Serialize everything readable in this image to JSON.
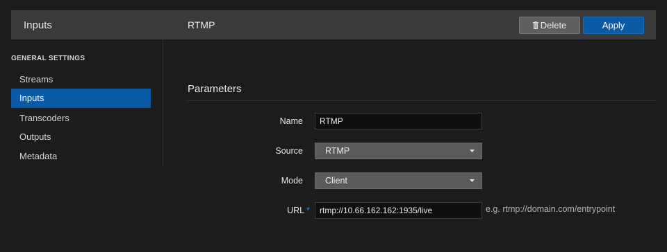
{
  "header": {
    "section_title": "Inputs",
    "page_title": "RTMP",
    "delete_label": "Delete",
    "apply_label": "Apply"
  },
  "sidebar": {
    "group_label": "GENERAL SETTINGS",
    "items": [
      {
        "label": "Streams",
        "active": false
      },
      {
        "label": "Inputs",
        "active": true
      },
      {
        "label": "Transcoders",
        "active": false
      },
      {
        "label": "Outputs",
        "active": false
      },
      {
        "label": "Metadata",
        "active": false
      }
    ]
  },
  "main": {
    "section_title": "Parameters",
    "fields": {
      "name": {
        "label": "Name",
        "value": "RTMP"
      },
      "source": {
        "label": "Source",
        "value": "RTMP"
      },
      "mode": {
        "label": "Mode",
        "value": "Client"
      },
      "url": {
        "label": "URL",
        "required_mark": "*",
        "value": "rtmp://10.66.162.162:1935/live",
        "hint": "e.g. rtmp://domain.com/entrypoint"
      }
    }
  },
  "colors": {
    "background": "#1c1c1c",
    "header": "#3a3a3a",
    "accent": "#0a5aa5",
    "delete_button": "#5f5f5f"
  },
  "icons": {
    "delete": "trash-icon",
    "dropdown": "caret-down-icon"
  }
}
